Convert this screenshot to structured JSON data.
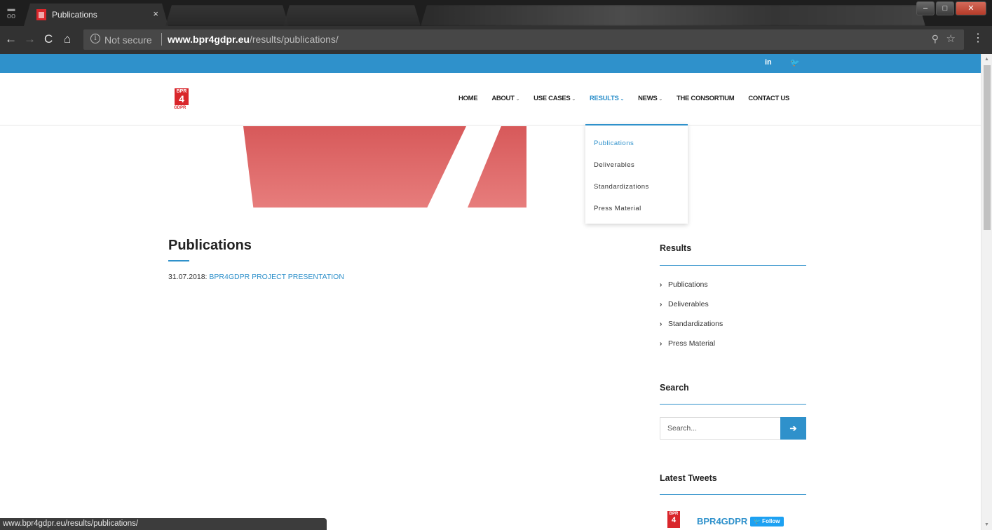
{
  "browser": {
    "tab_title": "Publications",
    "tab_close": "×",
    "security_label": "Not secure",
    "url_host": "www.bpr4gdpr.eu",
    "url_path": "/results/publications/",
    "window_controls": {
      "minimize": "–",
      "maximize": "□",
      "close": "✕"
    }
  },
  "social": {
    "linkedin": "in",
    "twitter": "🐦"
  },
  "logo": {
    "top": "BPR",
    "number": "4",
    "bottom": "GDPR"
  },
  "nav": {
    "items": [
      {
        "label": "HOME"
      },
      {
        "label": "ABOUT"
      },
      {
        "label": "USE CASES"
      },
      {
        "label": "RESULTS"
      },
      {
        "label": "NEWS"
      },
      {
        "label": "THE CONSORTIUM"
      },
      {
        "label": "CONTACT US"
      }
    ],
    "chevron": "⌄"
  },
  "dropdown": {
    "items": [
      {
        "label": "Publications"
      },
      {
        "label": "Deliverables"
      },
      {
        "label": "Standardizations"
      },
      {
        "label": "Press Material"
      }
    ]
  },
  "main": {
    "title": "Publications",
    "publication_date": "31.07.2018:",
    "publication_link": "BPR4GDPR PROJECT PRESENTATION"
  },
  "sidebar": {
    "results_heading": "Results",
    "results_links": [
      {
        "label": "Publications"
      },
      {
        "label": "Deliverables"
      },
      {
        "label": "Standardizations"
      },
      {
        "label": "Press Material"
      }
    ],
    "search_heading": "Search",
    "search_placeholder": "Search...",
    "search_button": "➔",
    "tweets_heading": "Latest Tweets",
    "tweet_account": "BPR4GDPR",
    "follow_label": "🐦 Follow"
  },
  "status_bar": {
    "url": "www.bpr4gdpr.eu/results/publications/"
  },
  "colors": {
    "accent": "#2f91cb",
    "brand_red": "#d9262b",
    "hero": "#df6868"
  }
}
